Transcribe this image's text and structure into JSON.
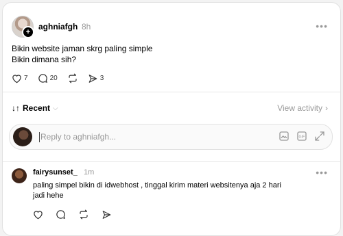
{
  "post": {
    "author": "aghniafgh",
    "time": "8h",
    "lines": [
      "Bikin website jaman skrg paling simple",
      "Bikin dimana sih?"
    ],
    "likes": "7",
    "comments": "20",
    "shares": "3"
  },
  "sort": {
    "label": "Recent",
    "view_activity": "View activity"
  },
  "reply": {
    "placeholder": "Reply to aghniafgh..."
  },
  "comment": {
    "author": "fairysunset_",
    "time": "1m",
    "lines": [
      "paling simpel bikin di idwebhost , tinggal kirim materi websitenya aja 2 hari",
      "jadi hehe"
    ]
  },
  "icons": {
    "like": "heart-icon",
    "comment": "comment-icon",
    "repost": "repost-icon",
    "share": "send-icon",
    "more": "more-icon",
    "plus": "plus-icon",
    "image": "image-icon",
    "gif": "gif-icon",
    "expand": "expand-icon"
  }
}
